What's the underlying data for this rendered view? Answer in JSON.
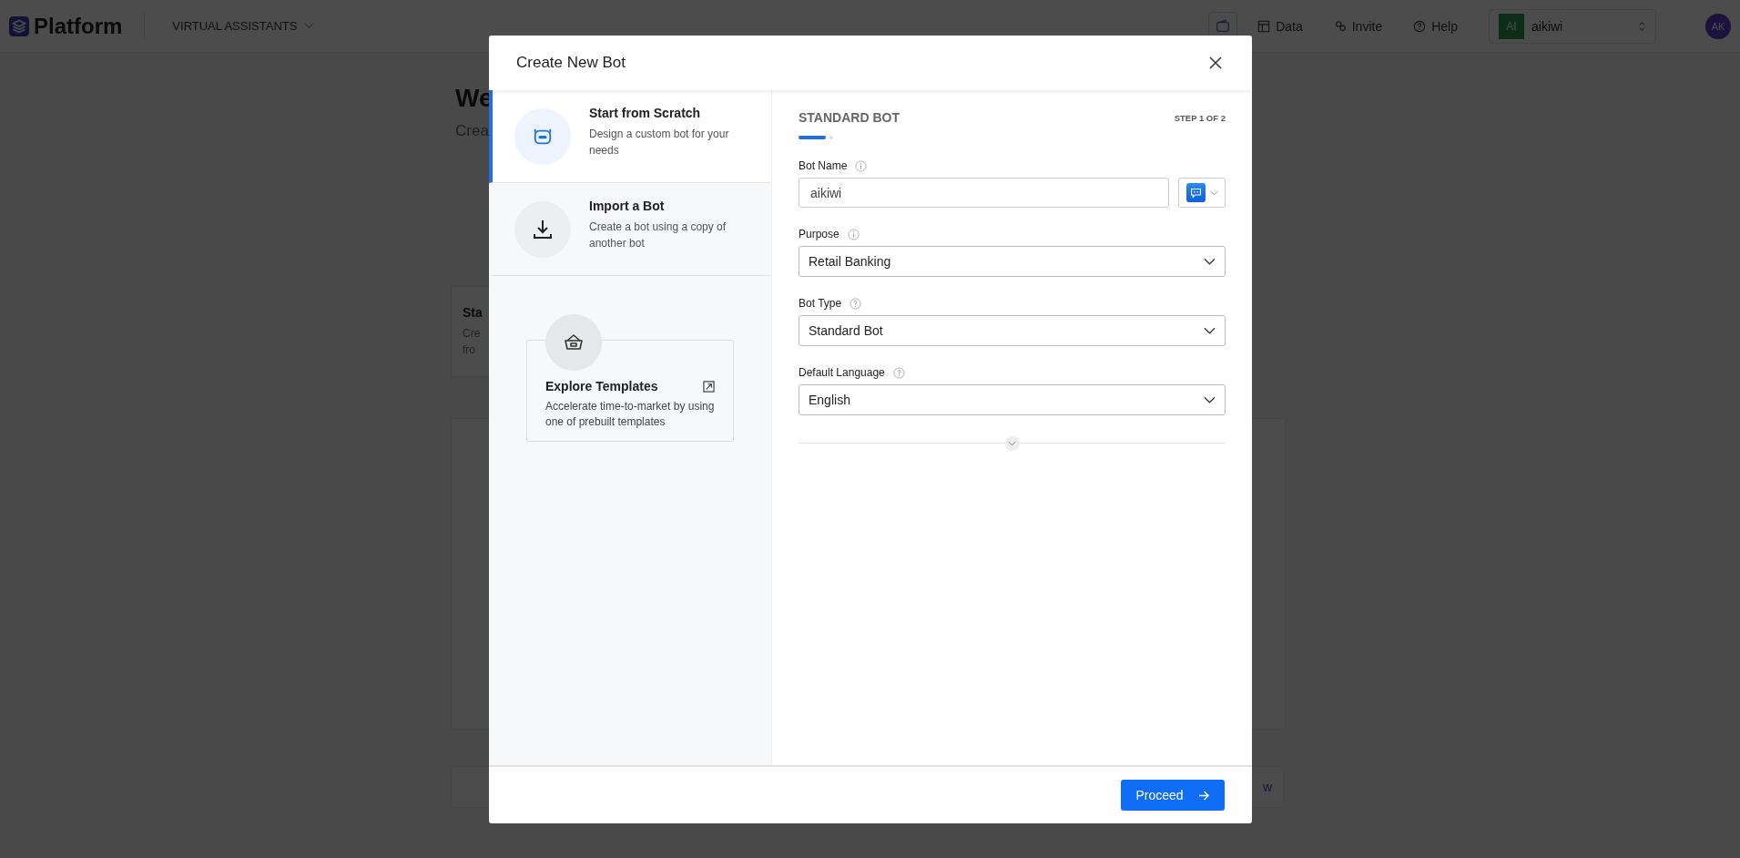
{
  "top_bar": {
    "logo": "Platform",
    "section": "VIRTUAL ASSISTANTS",
    "nav": [
      {
        "kind": "data",
        "label": "Data"
      },
      {
        "kind": "invite",
        "label": "Invite"
      },
      {
        "kind": "help",
        "label": "Help"
      }
    ],
    "workspace": {
      "initials": "AI",
      "name": "aikiwi"
    },
    "avatar": "AK"
  },
  "background_page": {
    "title": "We",
    "subtitle": "Crea",
    "card": {
      "title": "Sta",
      "lines": [
        "Cre",
        "fro"
      ]
    },
    "banner_link": "w"
  },
  "modal": {
    "title": "Create New Bot",
    "options": [
      {
        "kind": "scratch",
        "title": "Start from Scratch",
        "description": "Design a custom bot for your needs",
        "selected": true
      },
      {
        "kind": "import",
        "title": "Import a Bot",
        "description": "Create a bot using a copy of another bot",
        "selected": false
      }
    ],
    "templates": {
      "title": "Explore Templates",
      "description": "Accelerate time-to-market by using one of prebuilt templates"
    },
    "form": {
      "heading": "STANDARD BOT",
      "step": "STEP 1 OF 2",
      "steps": [
        {
          "selected": true
        },
        {
          "selected": false
        }
      ],
      "fields": [
        {
          "kind": "input",
          "label": "Bot Name",
          "hint": {
            "kind": "info"
          },
          "value": "aikiwi"
        },
        {
          "kind": "select",
          "label": "Purpose",
          "hint": {
            "kind": "info"
          },
          "value": "Retail Banking"
        },
        {
          "kind": "select",
          "label": "Bot Type",
          "hint": {
            "kind": "help"
          },
          "value": "Standard Bot"
        },
        {
          "kind": "select",
          "label": "Default Language",
          "hint": {
            "kind": "help"
          },
          "value": "English"
        }
      ]
    },
    "proceed_button": "Proceed"
  }
}
